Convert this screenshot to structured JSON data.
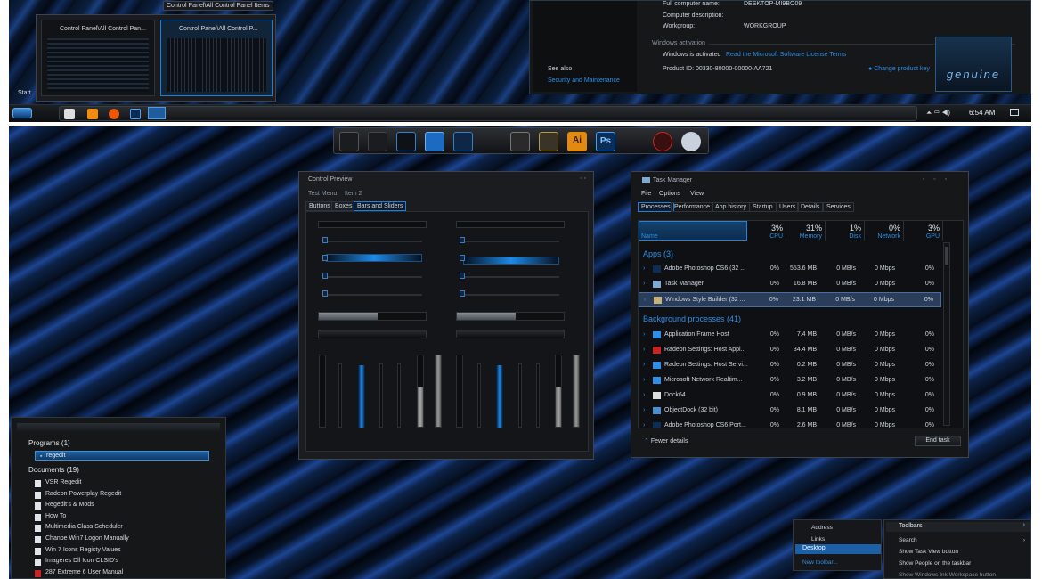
{
  "top_shot": {
    "thumb_tooltip": "Control Panel\\All Control Panel Items",
    "thumbs": [
      {
        "title": "Control Panel\\All Control Pan..."
      },
      {
        "title": "Control Panel\\All Control P..."
      }
    ],
    "start_label": "Start",
    "clock": "6:54 AM",
    "system": {
      "full_name_label": "Full computer name:",
      "full_name_value": "DESKTOP-MI9BO09",
      "desc_label": "Computer description:",
      "workgroup_label": "Workgroup:",
      "workgroup_value": "WORKGROUP",
      "activation_heading": "Windows activation",
      "activated_text": "Windows is activated",
      "license_link": "Read the Microsoft Software License Terms",
      "product_id": "Product ID: 00330-80000-00000-AA721",
      "change_key": "Change product key",
      "see_also": "See also",
      "security_link": "Security and Maintenance",
      "genuine": "genuine"
    }
  },
  "dock": {
    "icons": [
      "monitor-icon",
      "home-icon",
      "window-icon",
      "settings-icon",
      "gear-icon",
      "vs-icon",
      "brush-icon",
      "illustrator-icon",
      "photoshop-icon",
      "radeon-icon",
      "logo-icon"
    ],
    "ai_label": "Ai",
    "ps_label": "Ps"
  },
  "control_preview": {
    "title": "Control Preview",
    "menu": [
      "Test Menu",
      "Item 2"
    ],
    "tabs": [
      "Buttons",
      "Boxes",
      "Bars and Sliders"
    ]
  },
  "task_manager": {
    "title": "Task Manager",
    "menu": [
      "File",
      "Options",
      "View"
    ],
    "tabs": [
      "Processes",
      "Performance",
      "App history",
      "Startup",
      "Users",
      "Details",
      "Services"
    ],
    "columns": [
      {
        "pct": "",
        "name": "Name"
      },
      {
        "pct": "3%",
        "name": "CPU"
      },
      {
        "pct": "31%",
        "name": "Memory"
      },
      {
        "pct": "1%",
        "name": "Disk"
      },
      {
        "pct": "0%",
        "name": "Network"
      },
      {
        "pct": "3%",
        "name": "GPU"
      }
    ],
    "apps_heading": "Apps (3)",
    "apps": [
      {
        "name": "Adobe Photoshop CS6 (32 ...",
        "cpu": "0%",
        "mem": "553.6 MB",
        "disk": "0 MB/s",
        "net": "0 Mbps",
        "gpu": "0%",
        "icon": "photoshop-icon"
      },
      {
        "name": "Task Manager",
        "cpu": "0%",
        "mem": "16.8 MB",
        "disk": "0 MB/s",
        "net": "0 Mbps",
        "gpu": "0%",
        "icon": "taskmgr-icon"
      },
      {
        "name": "Windows Style Builder (32 ...",
        "cpu": "0%",
        "mem": "23.1 MB",
        "disk": "0 MB/s",
        "net": "0 Mbps",
        "gpu": "0%",
        "icon": "builder-icon"
      }
    ],
    "bg_heading": "Background processes (41)",
    "bg": [
      {
        "name": "Application Frame Host",
        "cpu": "0%",
        "mem": "7.4 MB",
        "disk": "0 MB/s",
        "net": "0 Mbps",
        "gpu": "0%"
      },
      {
        "name": "Radeon Settings: Host Appl...",
        "cpu": "0%",
        "mem": "34.4 MB",
        "disk": "0 MB/s",
        "net": "0 Mbps",
        "gpu": "0%"
      },
      {
        "name": "Radeon Settings: Host Servi...",
        "cpu": "0%",
        "mem": "0.2 MB",
        "disk": "0 MB/s",
        "net": "0 Mbps",
        "gpu": "0%"
      },
      {
        "name": "Microsoft Network Realtim...",
        "cpu": "0%",
        "mem": "3.2 MB",
        "disk": "0 MB/s",
        "net": "0 Mbps",
        "gpu": "0%"
      },
      {
        "name": "Dock64",
        "cpu": "0%",
        "mem": "0.9 MB",
        "disk": "0 MB/s",
        "net": "0 Mbps",
        "gpu": "0%"
      },
      {
        "name": "ObjectDock (32 bit)",
        "cpu": "0%",
        "mem": "8.1 MB",
        "disk": "0 MB/s",
        "net": "0 Mbps",
        "gpu": "0%"
      },
      {
        "name": "Adobe Photoshop CS6 Port...",
        "cpu": "0%",
        "mem": "2.6 MB",
        "disk": "0 MB/s",
        "net": "0 Mbps",
        "gpu": "0%"
      }
    ],
    "fewer_details": "Fewer details",
    "end_task": "End task"
  },
  "start_search": {
    "programs_heading": "Programs (1)",
    "program": "regedit",
    "documents_heading": "Documents (19)",
    "documents": [
      "VSR Regedit",
      "Radeon Powerplay Regedit",
      "Regedit's & Mods",
      "How To",
      "Multimedia Class Scheduler",
      "Chanbe Win7 Logon Manually",
      "Win 7 Icons Registy Values",
      "Imageres Dll Icon CLSID's",
      "287 Extreme 6 User Manual"
    ]
  },
  "context_menu": {
    "left": [
      "Address",
      "Links",
      "Desktop",
      "New toolbar..."
    ],
    "right": [
      "Toolbars",
      "Search",
      "Show Task View button",
      "Show People on the taskbar",
      "Show Windows Ink Workspace button"
    ]
  },
  "colors": {
    "accent": "#1e7fd8",
    "link": "#2f8fe8",
    "panel": "#141619"
  }
}
